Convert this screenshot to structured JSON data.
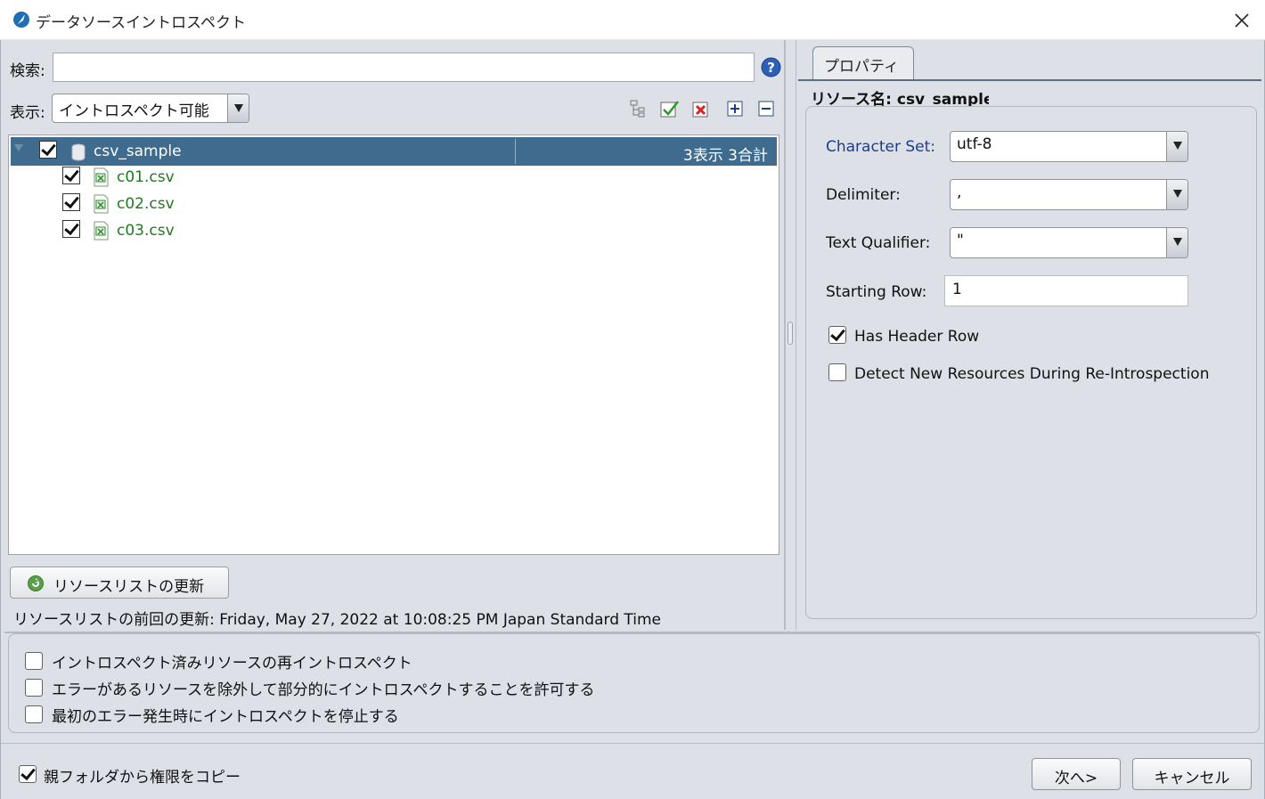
{
  "window": {
    "title": "データソースイントロスペクト",
    "close_label": "×"
  },
  "left": {
    "search_label": "検索:",
    "search_value": "",
    "view_label": "表示:",
    "view_value": "イントロスペクト可能",
    "toolbar_icons": [
      "copy-tree-icon",
      "check-all-icon",
      "uncheck-all-icon",
      "expand-all-icon",
      "collapse-all-icon"
    ],
    "tree": {
      "root": {
        "label": "csv_sample",
        "checked": true,
        "count_text": "3表示 3合計"
      },
      "children": [
        {
          "label": "c01.csv",
          "checked": true
        },
        {
          "label": "c02.csv",
          "checked": true
        },
        {
          "label": "c03.csv",
          "checked": true
        }
      ]
    },
    "refresh_button": "リソースリストの更新",
    "last_refresh": "リソースリストの前回の更新: Friday, May 27, 2022 at 10:08:25 PM Japan Standard Time"
  },
  "right": {
    "tab_label": "プロパティ",
    "resource_name": "リソース名: csv_sample",
    "character_set": {
      "label": "Character Set:",
      "value": "utf-8"
    },
    "delimiter": {
      "label": "Delimiter:",
      "value": ","
    },
    "text_qualifier": {
      "label": "Text Qualifier:",
      "value": "\""
    },
    "starting_row": {
      "label": "Starting Row:",
      "value": "1"
    },
    "has_header_row": {
      "label": "Has Header Row",
      "checked": true
    },
    "detect_new": {
      "label": "Detect New Resources During Re-Introspection",
      "checked": false
    }
  },
  "options": [
    {
      "label": "イントロスペクト済みリソースの再イントロスペクト",
      "checked": false
    },
    {
      "label": "エラーがあるリソースを除外して部分的にイントロスペクトすることを許可する",
      "checked": false
    },
    {
      "label": "最初のエラー発生時にイントロスペクトを停止する",
      "checked": false
    }
  ],
  "footer": {
    "copy_permissions": {
      "label": "親フォルダから権限をコピー",
      "checked": true
    },
    "next_button": "次へ>",
    "cancel_button": "キャンセル"
  },
  "colors": {
    "selection": "#3f6b8f",
    "file_text": "#1f7a1f",
    "link_label": "#1a3d8f",
    "dialog_bg": "#dde0e6"
  }
}
